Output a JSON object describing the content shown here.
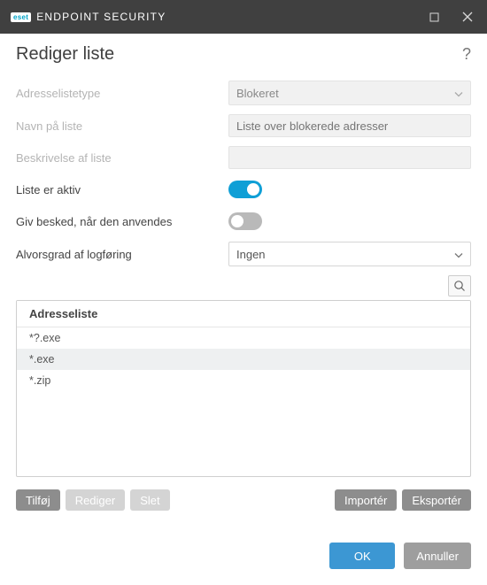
{
  "window": {
    "brand_logo": "eset",
    "brand_text": "ENDPOINT SECURITY"
  },
  "header": {
    "title": "Rediger liste",
    "help": "?"
  },
  "form": {
    "type_label": "Adresselistetype",
    "type_value": "Blokeret",
    "name_label": "Navn på liste",
    "name_placeholder": "Liste over blokerede adresser",
    "desc_label": "Beskrivelse af liste",
    "desc_value": "",
    "active_label": "Liste er aktiv",
    "active_on": true,
    "notify_label": "Giv besked, når den anvendes",
    "notify_on": false,
    "severity_label": "Alvorsgrad af logføring",
    "severity_value": "Ingen"
  },
  "table": {
    "header": "Adresseliste",
    "rows": [
      "*?.exe",
      "*.exe",
      "*.zip"
    ],
    "selected_index": 1
  },
  "buttons": {
    "add": "Tilføj",
    "edit": "Rediger",
    "delete": "Slet",
    "import": "Importér",
    "export": "Eksportér"
  },
  "footer": {
    "ok": "OK",
    "cancel": "Annuller"
  }
}
